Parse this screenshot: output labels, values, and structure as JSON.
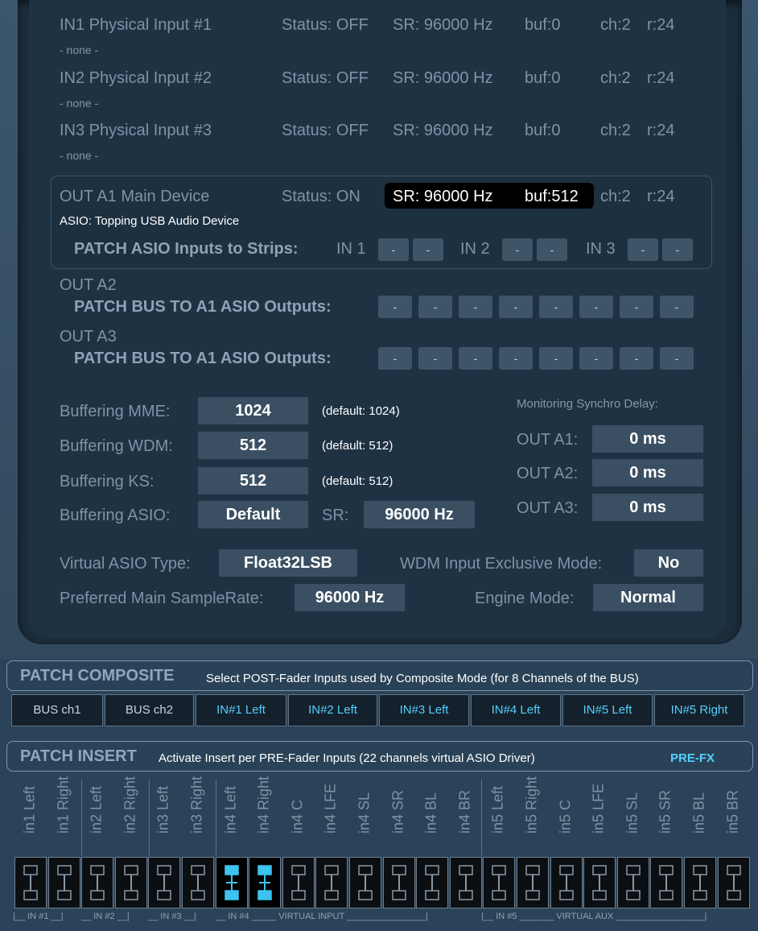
{
  "inputs": [
    {
      "name": "IN1 Physical Input #1",
      "device": "- none -",
      "status": "Status: OFF",
      "sr": "SR: 96000 Hz",
      "buf": "buf:0",
      "ch": "ch:2",
      "r": "r:24"
    },
    {
      "name": "IN2 Physical Input #2",
      "device": "- none -",
      "status": "Status: OFF",
      "sr": "SR: 96000 Hz",
      "buf": "buf:0",
      "ch": "ch:2",
      "r": "r:24"
    },
    {
      "name": "IN3 Physical Input #3",
      "device": "- none -",
      "status": "Status: OFF",
      "sr": "SR: 96000 Hz",
      "buf": "buf:0",
      "ch": "ch:2",
      "r": "r:24"
    }
  ],
  "out_a1": {
    "name": "OUT A1 Main Device",
    "status": "Status: ON",
    "sr": "SR: 96000 Hz",
    "buf": "buf:512",
    "ch": "ch:2",
    "r": "r:24",
    "device": "ASIO: Topping USB Audio Device",
    "patch_label": "PATCH ASIO Inputs to Strips:",
    "in1": "IN 1",
    "in2": "IN 2",
    "in3": "IN 3",
    "btn": "-"
  },
  "out_a2": {
    "name": "OUT A2",
    "patch_label": "PATCH BUS TO A1 ASIO Outputs:",
    "btn": "-"
  },
  "out_a3": {
    "name": "OUT A3",
    "patch_label": "PATCH BUS TO A1 ASIO Outputs:",
    "btn": "-"
  },
  "buffering": {
    "mme": {
      "label": "Buffering MME:",
      "value": "1024",
      "default": "(default: 1024)"
    },
    "wdm": {
      "label": "Buffering WDM:",
      "value": "512",
      "default": "(default: 512)"
    },
    "ks": {
      "label": "Buffering KS:",
      "value": "512",
      "default": "(default: 512)"
    },
    "asio": {
      "label": "Buffering ASIO:",
      "value": "Default",
      "sr_label": "SR:",
      "sr_value": "96000 Hz"
    }
  },
  "monitoring": {
    "title": "Monitoring Synchro Delay:",
    "a1": {
      "label": "OUT A1:",
      "value": "0 ms"
    },
    "a2": {
      "label": "OUT A2:",
      "value": "0 ms"
    },
    "a3": {
      "label": "OUT A3:",
      "value": "0 ms"
    }
  },
  "settings": {
    "asio_type": {
      "label": "Virtual ASIO Type:",
      "value": "Float32LSB"
    },
    "wdm_excl": {
      "label": "WDM Input Exclusive Mode:",
      "value": "No"
    },
    "samplerate": {
      "label": "Preferred Main SampleRate:",
      "value": "96000 Hz"
    },
    "engine": {
      "label": "Engine Mode:",
      "value": "Normal"
    }
  },
  "composite": {
    "title": "PATCH COMPOSITE",
    "description": "Select POST-Fader Inputs used by Composite Mode (for 8 Channels of the BUS)",
    "buttons": [
      "BUS ch1",
      "BUS ch2",
      "IN#1 Left",
      "IN#2 Left",
      "IN#3 Left",
      "IN#4 Left",
      "IN#5 Left",
      "IN#5 Right"
    ]
  },
  "insert": {
    "title": "PATCH INSERT",
    "description": "Activate Insert per PRE-Fader Inputs (22 channels virtual ASIO Driver)",
    "mode": "PRE-FX",
    "channels": [
      "in1 Left",
      "in1 Right",
      "in2 Left",
      "in2 Right",
      "in3 Left",
      "in3 Right",
      "in4 Left",
      "in4 Right",
      "in4 C",
      "in4 LFE",
      "in4 SL",
      "in4 SR",
      "in4 BL",
      "in4 BR",
      "in5 Left",
      "in5 Right",
      "in5 C",
      "in5 LFE",
      "in5 SL",
      "in5 SR",
      "in5 BL",
      "in5 BR"
    ],
    "active": [
      7,
      8
    ],
    "groups": {
      "g1": "IN #1",
      "g2": "IN #2",
      "g3": "IN #3",
      "g4": "IN #4",
      "vin": "VIRTUAL INPUT",
      "g5": "IN #5",
      "vaux": "VIRTUAL AUX"
    }
  },
  "colors": {
    "accent": "#55d0ff",
    "bg": "#1f3244",
    "field": "#3a4f62",
    "active_insert": "#3cc3f0"
  }
}
